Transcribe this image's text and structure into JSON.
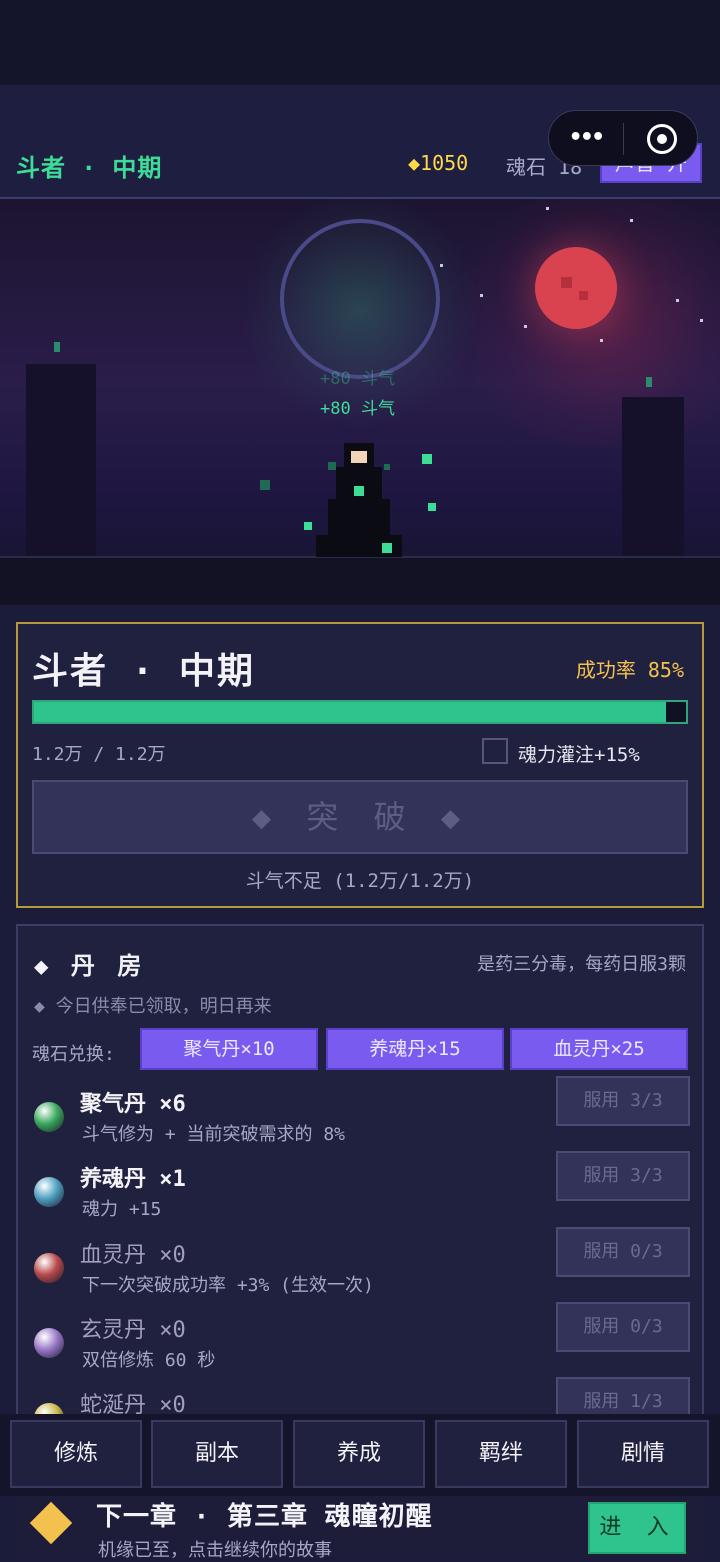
{
  "header": {
    "realm": "斗者 · 中期",
    "coins": "◆1050",
    "soulstone": "魂石 18",
    "sound_button": "声音 开"
  },
  "scene": {
    "gain_faded": "+80 斗气",
    "gain": "+80 斗气"
  },
  "breakthrough": {
    "title": "斗者 · 中期",
    "success_rate": "成功率 85%",
    "progress_text": "1.2万 / 1.2万",
    "progress_fraction": 0.97,
    "soul_infuse_label": "魂力灌注+15%",
    "soul_infuse_checked": false,
    "button_label": "◆ 突 破 ◆",
    "note": "斗气不足 (1.2万/1.2万)"
  },
  "alchemy": {
    "title": "◆ 丹 房",
    "quote": "是药三分毒，每药日服3颗",
    "notice": "◆ 今日供奉已领取，明日再来",
    "exchange_label": "魂石兑换:",
    "exchange": [
      "聚气丹×10",
      "养魂丹×15",
      "血灵丹×25"
    ],
    "pills": [
      {
        "name": "聚气丹 ×6",
        "desc": "斗气修为 + 当前突破需求的 8%",
        "use": "服用 3/3",
        "color": "#3aa85e"
      },
      {
        "name": "养魂丹 ×1",
        "desc": "魂力 +15",
        "use": "服用 3/3",
        "color": "#4fa0c0"
      },
      {
        "name": "血灵丹 ×0",
        "desc": "下一次突破成功率 +3% (生效一次)",
        "use": "服用 0/3",
        "color": "#b84a4a"
      },
      {
        "name": "玄灵丹 ×0",
        "desc": "双倍修炼 60 秒",
        "use": "服用 0/3",
        "color": "#9a78c8"
      },
      {
        "name": "蛇涎丹 ×0",
        "desc": "",
        "use": "服用 1/3",
        "color": "#c8b84a"
      }
    ]
  },
  "nav": [
    "修炼",
    "副本",
    "养成",
    "羁绊",
    "剧情"
  ],
  "chapter": {
    "title": "下一章 · 第三章 魂瞳初醒",
    "subtitle": "机缘已至，点击继续你的故事",
    "enter": "进 入"
  }
}
